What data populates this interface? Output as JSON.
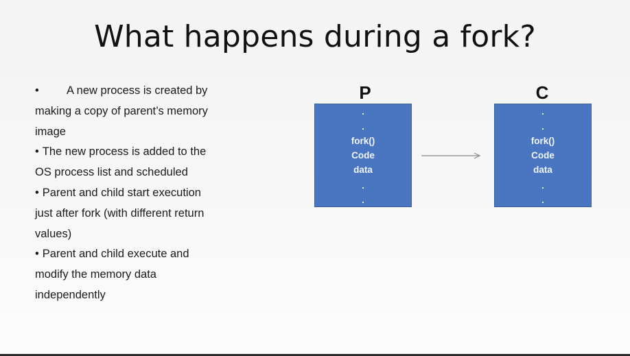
{
  "slide": {
    "title": "What happens during a fork?",
    "bullets": [
      "A new process is created by making a copy of parent’s memory image",
      "The new process is added to the OS process list and scheduled",
      "Parent and child start execution just after fork (with different return values)",
      "Parent and child execute and modify the memory data independently"
    ]
  },
  "diagram": {
    "parent": {
      "label": "P",
      "lines": [
        "fork()",
        "Code",
        "data"
      ]
    },
    "child": {
      "label": "C",
      "lines": [
        "fork()",
        "Code",
        "data"
      ]
    }
  },
  "colors": {
    "box_fill": "#4a76c1",
    "box_text": "#f2f6ff",
    "arrow": "#888888"
  }
}
